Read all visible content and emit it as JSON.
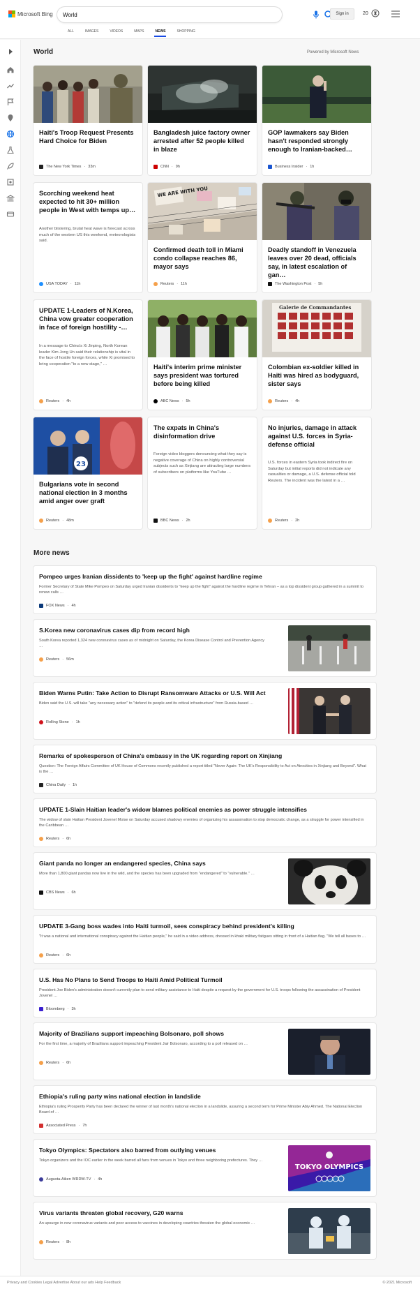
{
  "header": {
    "logo_text": "Microsoft Bing",
    "search_value": "World",
    "signin_label": "Sign in",
    "rewards_count": "20",
    "tabs": [
      "ALL",
      "IMAGES",
      "VIDEOS",
      "MAPS",
      "NEWS",
      "SHOPPING"
    ],
    "active_tab": "NEWS"
  },
  "world": {
    "title": "World",
    "powered_by": "Powered by Microsoft News",
    "cards": [
      {
        "title": "Haiti's Troop Request Presents Hard Choice for Biden",
        "source": "The New York Times",
        "time": "33m"
      },
      {
        "title": "Bangladesh juice factory owner arrested after 52 people killed in blaze",
        "source": "CNN",
        "time": "9h"
      },
      {
        "title": "GOP lawmakers say Biden hasn't responded strongly enough to Iranian-backed…",
        "source": "Business Insider",
        "time": "1h"
      },
      {
        "title": "Scorching weekend heat expected to hit 30+ million people in West with temps up…",
        "snippet": "Another blistering, brutal heat wave is forecast across much of the western US this weekend, meteorologists said.",
        "source": "USA TODAY",
        "time": "11h"
      },
      {
        "title": "Confirmed death toll in Miami condo collapse reaches 86, mayor says",
        "source": "Reuters",
        "time": "11h"
      },
      {
        "title": "Deadly standoff in Venezuela leaves over 20 dead, officials say, in latest escalation of gan…",
        "source": "The Washington Post",
        "time": "5h"
      },
      {
        "title": "UPDATE 1-Leaders of N.Korea, China vow greater cooperation in face of foreign hostility -…",
        "snippet": "In a message to China's Xi Jinping, North Korean leader Kim Jong Un said their relationship is vital in the face of hostile foreign forces, while Xi promised to bring cooperation \"to a new stage,\" …",
        "source": "Reuters",
        "time": "4h"
      },
      {
        "title": "Haiti's interim prime minister says president was tortured before being killed",
        "source": "ABC News",
        "time": "5h"
      },
      {
        "title": "Colombian ex-soldier killed in Haiti was hired as bodyguard, sister says",
        "source": "Reuters",
        "time": "4h"
      },
      {
        "title": "Bulgarians vote in second national election in 3 months amid anger over graft",
        "source": "Reuters",
        "time": "48m"
      },
      {
        "title": "The expats in China's disinformation drive",
        "snippet": "Foreign video bloggers denouncing what they say is negative coverage of China on highly controversial subjects such as Xinjiang are attracting large numbers of subscribers on platforms like YouTube …",
        "source": "BBC News",
        "time": "2h"
      },
      {
        "title": "No injuries, damage in attack against U.S. forces in Syria-defense official",
        "snippet": "U.S. forces in eastern Syria took indirect fire on Saturday but initial reports did not indicate any casualties or damage, a U.S. defense official told Reuters. The incident was the latest in a …",
        "source": "Reuters",
        "time": "2h"
      }
    ]
  },
  "more_news": {
    "title": "More news",
    "items": [
      {
        "title": "Pompeo urges Iranian dissidents to 'keep up the fight' against hardline regime",
        "snippet": "Former Secretary of State Mike Pompeo on Saturday urged Iranian dissidents to \"keep up the fight\" against the hardline regime in Tehran – as a top dissident group gathered in a summit to renew calls …",
        "source": "FOX News",
        "time": "4h"
      },
      {
        "title": "S.Korea new coronavirus cases dip from record high",
        "snippet": "South Korea reported 1,324 new coronavirus cases as of midnight on Saturday, the Korea Disease Control and Prevention Agency …",
        "source": "Reuters",
        "time": "56m"
      },
      {
        "title": "Biden Warns Putin: Take Action to Disrupt Ransomware Attacks or U.S. Will Act",
        "snippet": "Biden said the U.S. will take \"any necessary action\" to \"defend its people and its critical infrastructure\" from Russia-based …",
        "source": "Rolling Stone",
        "time": "1h"
      },
      {
        "title": "Remarks of spokesperson of China's embassy in the UK regarding report on Xinjiang",
        "snippet": "Question: The Foreign Affairs Committee of UK House of Commons recently published a report titled \"Never Again: The UK's Responsibility to Act on Atrocities in Xinjiang and Beyond\". What is the …",
        "source": "China Daily",
        "time": "1h"
      },
      {
        "title": "UPDATE 1-Slain Haitian leader's widow blames political enemies as power struggle intensifies",
        "snippet": "The widow of slain Haitian President Jovenel Moise on Saturday accused shadowy enemies of organizing his assassination to stop democratic change, as a struggle for power intensified in the Caribbean …",
        "source": "Reuters",
        "time": "6h"
      },
      {
        "title": "Giant panda no longer an endangered species, China says",
        "snippet": "More than 1,800 giant pandas now live in the wild, and the species has been upgraded from \"endangered\" to \"vulnerable.\" …",
        "source": "CBS News",
        "time": "6h"
      },
      {
        "title": "UPDATE 3-Gang boss wades into Haiti turmoil, sees conspiracy behind president's killing",
        "snippet": "\"It was a national and international conspiracy against the Haitian people,\" he said in a video address, dressed in khaki military fatigues sitting in front of a Haitian flag. \"We tell all bases to …",
        "source": "Reuters",
        "time": "6h"
      },
      {
        "title": "U.S. Has No Plans to Send Troops to Haiti Amid Political Turmoil",
        "snippet": "President Joe Biden's administration doesn't currently plan to send military assistance to Haiti despite a request by the government for U.S. troops following the assassination of President Jovenel …",
        "source": "Bloomberg",
        "time": "3h"
      },
      {
        "title": "Majority of Brazilians support impeaching Bolsonaro, poll shows",
        "snippet": "For the first time, a majority of Brazilians support impeaching President Jair Bolsonaro, according to a poll released on …",
        "source": "Reuters",
        "time": "6h"
      },
      {
        "title": "Ethiopia's ruling party wins national election in landslide",
        "snippet": "Ethiopia's ruling Prosperity Party has been declared the winner of last month's national election in a landslide, assuring a second term for Prime Minister Abiy Ahmed. The National Election Board of …",
        "source": "Associated Press",
        "time": "7h"
      },
      {
        "title": "Tokyo Olympics: Spectators also barred from outlying venues",
        "snippet": "Tokyo organizers and the IOC earlier in the week barred all fans from venues in Tokyo and three neighboring prefectures. They …",
        "source": "Augusta-Aiken WRDW-TV",
        "time": "4h"
      },
      {
        "title": "Virus variants threaten global recovery, G20 warns",
        "snippet": "An upsurge in new coronavirus variants and poor access to vaccines in developing countries threaten the global economic …",
        "source": "Reuters",
        "time": "8h"
      }
    ]
  },
  "thumbnail_text": {
    "sign_text": "WE ARE WITH YOU",
    "museum_sign": "Galerie de Commandantes",
    "election_number": "23",
    "olympics_text": "TOKYO OLYMPICS"
  },
  "footer": {
    "left": "Privacy and Cookies   Legal   Advertise   About our ads   Help   Feedback",
    "right": "© 2021 Microsoft"
  },
  "colors": {
    "accent": "#174ae4",
    "background": "#f7f7f7"
  },
  "icons": [
    "microsoft-logo-icon",
    "mic-icon",
    "search-icon",
    "rewards-icon",
    "hamburger-menu-icon"
  ]
}
